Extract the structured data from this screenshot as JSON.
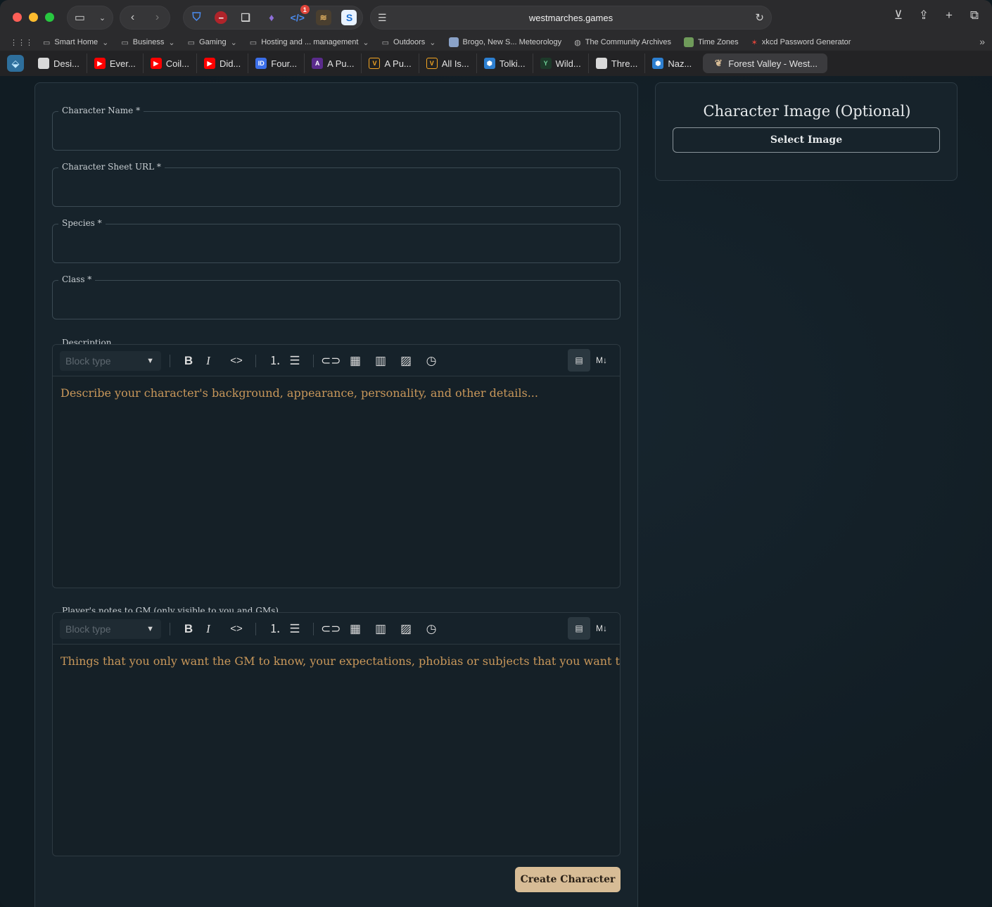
{
  "browser": {
    "url": "westmarches.games",
    "extension_badge": "1",
    "bookmarks": [
      {
        "label": "Smart Home",
        "folder": true
      },
      {
        "label": "Business",
        "folder": true
      },
      {
        "label": "Gaming",
        "folder": true
      },
      {
        "label": "Hosting and ... management",
        "folder": true
      },
      {
        "label": "Outdoors",
        "folder": true
      },
      {
        "label": "Brogo, New S... Meteorology",
        "folder": false
      },
      {
        "label": "The Community Archives",
        "folder": false
      },
      {
        "label": "Time Zones",
        "folder": false
      },
      {
        "label": "xkcd Password Generator",
        "folder": false
      }
    ],
    "tabs": [
      {
        "label": "Desi...",
        "color": "#d9d9d9"
      },
      {
        "label": "Ever...",
        "color": "#ff0000"
      },
      {
        "label": "Coil...",
        "color": "#ff0000"
      },
      {
        "label": "Did...",
        "color": "#ff0000"
      },
      {
        "label": "Four...",
        "color": "#3b6ee8"
      },
      {
        "label": "A Pu...",
        "color": "#5a2b8c"
      },
      {
        "label": "A Pu...",
        "color": "#f5a623"
      },
      {
        "label": "All Is...",
        "color": "#f5a623"
      },
      {
        "label": "Tolki...",
        "color": "#2d7fd0"
      },
      {
        "label": "Wild...",
        "color": "#2e8b57"
      },
      {
        "label": "Thre...",
        "color": "#d9d9d9"
      },
      {
        "label": "Naz...",
        "color": "#2d7fd0"
      }
    ],
    "active_tab": "Forest Valley - West..."
  },
  "form": {
    "character_name_label": "Character Name *",
    "character_sheet_url_label": "Character Sheet URL *",
    "species_label": "Species *",
    "class_label": "Class *",
    "description_label": "Description",
    "description_placeholder": "Describe your character's background, appearance, personality, and other details...",
    "notes_label": "Player's notes to GM (only visible to you and GMs)",
    "notes_placeholder": "Things that you only want the GM to know, your expectations, phobias or subjects that you want to stay a",
    "block_type_placeholder": "Block type",
    "create_button": "Create Character"
  },
  "sidebar": {
    "title": "Character Image (Optional)",
    "select_button": "Select Image"
  },
  "colors": {
    "accent_button": "#d7bc96",
    "placeholder_text": "#c8975a",
    "page_background": "#111c23"
  }
}
